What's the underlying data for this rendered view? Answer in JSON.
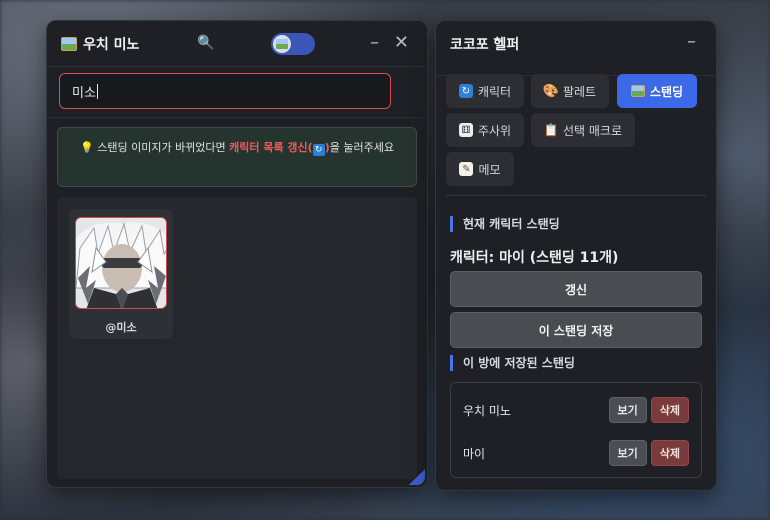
{
  "left_window": {
    "title": "우치 미노",
    "search": {
      "value": "미소"
    },
    "notice": {
      "prefix": "스탠딩 이미지가 바뀌었다면 ",
      "highlight": "캐릭터 목록 갱신(",
      "highlight_end": ")",
      "suffix": "을 눌러주세요"
    },
    "cards": [
      {
        "name": "@미소"
      }
    ]
  },
  "right_window": {
    "title": "코코포 헬퍼",
    "tabs": [
      {
        "label": "캐릭터",
        "icon": "refresh-icon"
      },
      {
        "label": "팔레트",
        "icon": "palette-icon"
      },
      {
        "label": "스탠딩",
        "icon": "picture-icon",
        "active": true
      },
      {
        "label": "주사위",
        "icon": "dice-icon"
      },
      {
        "label": "선택 매크로",
        "icon": "clipboard-icon"
      },
      {
        "label": "메모",
        "icon": "memo-icon"
      }
    ],
    "current_section": "현재 캐릭터 스탠딩",
    "current_character": "캐릭터: 마이 (스탠딩 11개)",
    "refresh_button": "갱신",
    "save_button": "이 스탠딩 저장",
    "saved_section": "이 방에 저장된 스탠딩",
    "saved": [
      {
        "name": "우치 미노",
        "view": "보기",
        "delete": "삭제"
      },
      {
        "name": "마이",
        "view": "보기",
        "delete": "삭제"
      }
    ]
  },
  "colors": {
    "accent": "#3b69e8",
    "danger": "#d84f4f",
    "delete_bg": "#7a3b3d"
  }
}
